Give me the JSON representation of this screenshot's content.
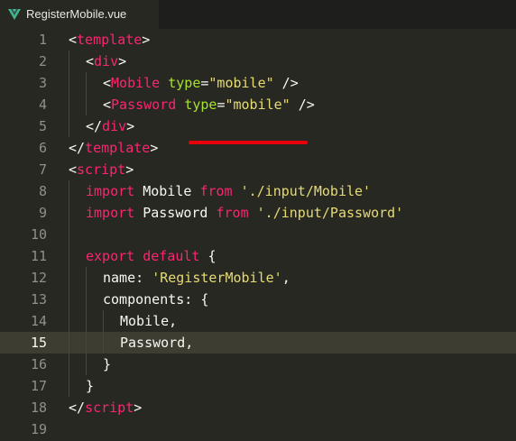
{
  "tab": {
    "label": "RegisterMobile.vue",
    "icon": "vue-logo-icon",
    "icon_color": "#41b883"
  },
  "annotation": {
    "color": "#e8000a"
  },
  "lines": [
    {
      "num": "1",
      "tokens": [
        "<",
        "template",
        ">"
      ]
    },
    {
      "num": "2",
      "tokens": [
        "<",
        "div",
        ">"
      ]
    },
    {
      "num": "3",
      "tokens": [
        "<",
        "Mobile",
        " ",
        "type",
        "=",
        "\"mobile\"",
        " />"
      ]
    },
    {
      "num": "4",
      "tokens": [
        "<",
        "Password",
        " ",
        "type",
        "=",
        "\"mobile\"",
        " />"
      ]
    },
    {
      "num": "5",
      "tokens": [
        "</",
        "div",
        ">"
      ]
    },
    {
      "num": "6",
      "tokens": [
        "</",
        "template",
        ">"
      ]
    },
    {
      "num": "7",
      "tokens": [
        "<",
        "script",
        ">"
      ]
    },
    {
      "num": "8",
      "tokens": [
        "import",
        " Mobile ",
        "from",
        " ",
        "'./input/Mobile'"
      ]
    },
    {
      "num": "9",
      "tokens": [
        "import",
        " Password ",
        "from",
        " ",
        "'./input/Password'"
      ]
    },
    {
      "num": "10",
      "tokens": []
    },
    {
      "num": "11",
      "tokens": [
        "export",
        " ",
        "default",
        " {"
      ]
    },
    {
      "num": "12",
      "tokens": [
        "name: ",
        "'RegisterMobile'",
        ","
      ]
    },
    {
      "num": "13",
      "tokens": [
        "components: {"
      ]
    },
    {
      "num": "14",
      "tokens": [
        "Mobile,"
      ]
    },
    {
      "num": "15",
      "tokens": [
        "Password,"
      ]
    },
    {
      "num": "16",
      "tokens": [
        "}"
      ]
    },
    {
      "num": "17",
      "tokens": [
        "}"
      ]
    },
    {
      "num": "18",
      "tokens": [
        "</",
        "script",
        ">"
      ]
    },
    {
      "num": "19",
      "tokens": []
    }
  ]
}
